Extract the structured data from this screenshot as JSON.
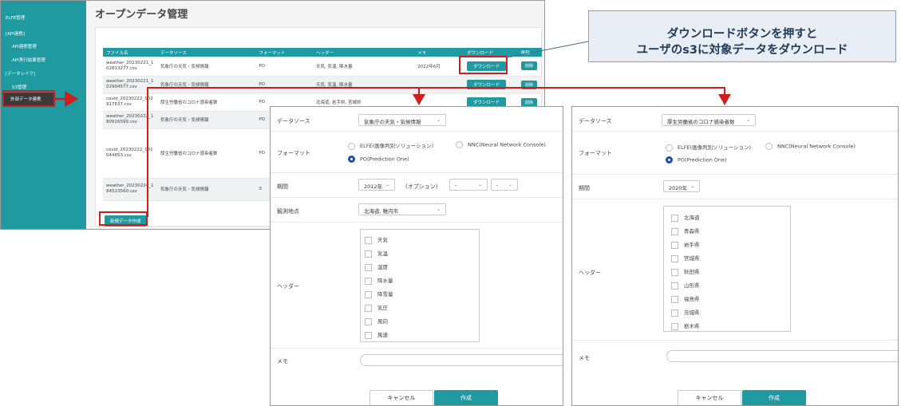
{
  "sidebar": {
    "items": [
      "ELFE管理",
      "[API連携]",
      "API連携管理",
      "API実行結果管理",
      "[データレイク]",
      "S3管理",
      "外部データ連携"
    ]
  },
  "main": {
    "title": "オープンデータ管理",
    "columns": [
      "ファイル名",
      "データソース",
      "フォーマット",
      "ヘッダー",
      "メモ",
      "ダウンロード",
      "削除"
    ],
    "rows": [
      {
        "file": "weather_20230221_102813277.csv",
        "source": "気象庁の天気・気候情報",
        "format": "PO",
        "header": "天気, 気温, 降水量",
        "memo": "2022年6月"
      },
      {
        "file": "weather_20230221_102904577.csv",
        "source": "気象庁の天気・気候情報",
        "format": "PO",
        "header": "天気, 気温, 降水量",
        "memo": ""
      },
      {
        "file": "covid_20230222_102917637.csv",
        "source": "厚生労働省のコロナ感染者数",
        "format": "PO",
        "header": "北海道, 岩手県, 宮城県",
        "memo": ""
      },
      {
        "file": "weather_20230222_180916599.csv",
        "source": "気象庁の天気・気候情報",
        "format": "PO",
        "header": "",
        "memo": ""
      },
      {
        "file": "covid_20230222_181044853.csv",
        "source": "厚生労働省のコロナ感染者数",
        "format": "PO",
        "header": "",
        "memo": ""
      },
      {
        "file": "weather_20230224_194523560.csv",
        "source": "気象庁の天気・気候情報",
        "format": "0",
        "header": "",
        "memo": ""
      }
    ],
    "download_label": "ダウンロード",
    "delete_label": "削除",
    "new_button": "新規データ作成"
  },
  "callout": {
    "line1": "ダウンロードボタンを押すと",
    "line2": "ユーザのs3に対象データをダウンロード"
  },
  "form1": {
    "datasource_label": "データソース",
    "datasource_value": "気象庁の天気・気候情報",
    "format_label": "フォーマット",
    "format_options": [
      "ELFE(画像判別ソリューション)",
      "NNC(Neural Network Console)",
      "PO(Prediction One)"
    ],
    "format_selected": "PO(Prediction One)",
    "period_label": "期間",
    "period_value": "2012年",
    "option_label": "(オプション)",
    "option_value1": "-",
    "option_value2": "-",
    "station_label": "観測地点",
    "station_value": "北海道, 稚内市",
    "header_label": "ヘッダー",
    "headers": [
      "天気",
      "気温",
      "湿度",
      "降水量",
      "降雪量",
      "気圧",
      "風向",
      "風速"
    ],
    "memo_label": "メモ",
    "cancel": "キャンセル",
    "create": "作成"
  },
  "form2": {
    "datasource_label": "データソース",
    "datasource_value": "厚生労働省のコロナ感染者数",
    "format_label": "フォーマット",
    "format_options": [
      "ELFE(画像判別ソリューション)",
      "NNC(Neural Network Console)",
      "PO(Prediction One)"
    ],
    "format_selected": "PO(Prediction One)",
    "period_label": "期間",
    "period_value": "2020年",
    "header_label": "ヘッダー",
    "headers": [
      "北海道",
      "青森県",
      "岩手県",
      "宮城県",
      "秋田県",
      "山形県",
      "福島県",
      "茨城県",
      "栃木県"
    ],
    "memo_label": "メモ",
    "cancel": "キャンセル",
    "create": "作成"
  },
  "colors": {
    "accent": "#1e9aa0",
    "highlight": "#d01e1e",
    "callout_border": "#8aa0b6",
    "radio": "#1f4e9c"
  }
}
